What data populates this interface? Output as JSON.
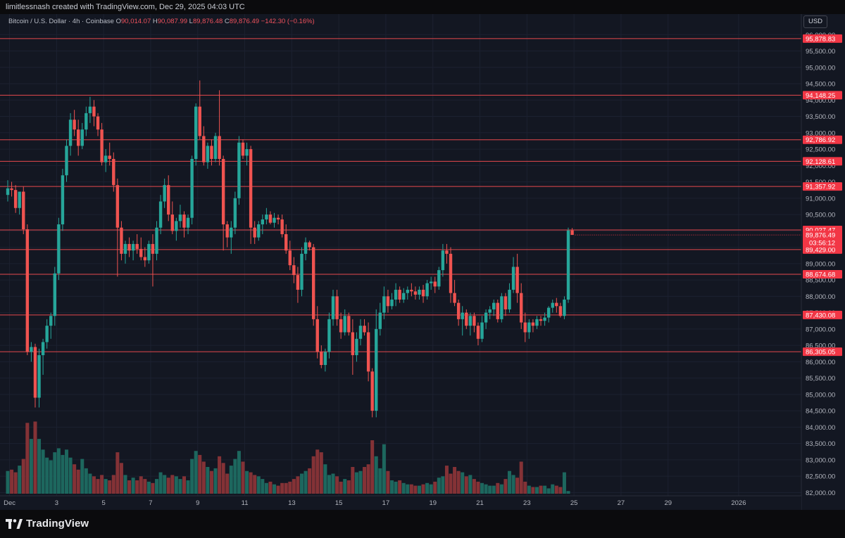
{
  "header": {
    "author": "limitlessnash created with TradingView.com, Dec 29, 2025 04:03 UTC"
  },
  "legend": {
    "symbol": "Bitcoin / U.S. Dollar · 4h · Coinbase",
    "open_label": "O",
    "open": "90,014.07",
    "high_label": "H",
    "high": "90,087.99",
    "low_label": "L",
    "low": "89,876.48",
    "close_label": "C",
    "close": "89,876.49",
    "change": "−142.30 (−0.16%)"
  },
  "currency_button": "USD",
  "brand": {
    "name": "TradingView",
    "logo_icon": "tradingview-logo-icon"
  },
  "colors": {
    "background": "#131722",
    "up": "#26a69a",
    "down": "#ef5350",
    "level_line": "#e5484d",
    "level_label_bg": "#f23645",
    "grid": "#1c2130",
    "axis_text": "#b2b5be"
  },
  "chart_data": {
    "type": "candlestick",
    "symbol": "BTC/USD",
    "exchange": "Coinbase",
    "interval": "4h",
    "grid": true,
    "ylim": [
      81900,
      96200
    ],
    "y_ticks": [
      82000,
      82500,
      83000,
      83500,
      84000,
      84500,
      85000,
      85500,
      86000,
      86500,
      87000,
      87500,
      88000,
      88500,
      89000,
      89500,
      90000,
      90500,
      91000,
      91500,
      92000,
      92500,
      93000,
      93500,
      94000,
      94500,
      95000,
      95500,
      96000
    ],
    "y_tick_labels": [
      "82,000.00",
      "82,500.00",
      "83,000.00",
      "83,500.00",
      "84,000.00",
      "84,500.00",
      "85,000.00",
      "85,500.00",
      "86,000.00",
      "86,500.00",
      "87,000.00",
      "87,500.00",
      "88,000.00",
      "88,500.00",
      "89,000.00",
      "89,500.00",
      "90,000.00",
      "90,500.00",
      "91,000.00",
      "91,500.00",
      "92,000.00",
      "92,500.00",
      "93,000.00",
      "93,500.00",
      "94,000.00",
      "94,500.00",
      "95,000.00",
      "95,500.00",
      "96,000.00"
    ],
    "x_range": [
      "2025-11-30 20:00",
      "2026-01-03 16:00"
    ],
    "x_ticks": [
      {
        "label": "Dec",
        "t": "2025-12-01 00:00"
      },
      {
        "label": "3",
        "t": "2025-12-03 00:00"
      },
      {
        "label": "5",
        "t": "2025-12-05 00:00"
      },
      {
        "label": "7",
        "t": "2025-12-07 00:00"
      },
      {
        "label": "9",
        "t": "2025-12-09 00:00"
      },
      {
        "label": "11",
        "t": "2025-12-11 00:00"
      },
      {
        "label": "13",
        "t": "2025-12-13 00:00"
      },
      {
        "label": "15",
        "t": "2025-12-15 00:00"
      },
      {
        "label": "17",
        "t": "2025-12-17 00:00"
      },
      {
        "label": "19",
        "t": "2025-12-19 00:00"
      },
      {
        "label": "21",
        "t": "2025-12-21 00:00"
      },
      {
        "label": "23",
        "t": "2025-12-23 00:00"
      },
      {
        "label": "25",
        "t": "2025-12-25 00:00"
      },
      {
        "label": "27",
        "t": "2025-12-27 00:00"
      },
      {
        "label": "29",
        "t": "2025-12-29 00:00"
      },
      {
        "label": "2026",
        "t": "2026-01-01 00:00"
      }
    ],
    "levels": [
      {
        "value": 95878.83,
        "label": "95,878.83"
      },
      {
        "value": 94148.25,
        "label": "94,148.25"
      },
      {
        "value": 92786.92,
        "label": "92,786.92"
      },
      {
        "value": 92128.61,
        "label": "92,128.61"
      },
      {
        "value": 91357.92,
        "label": "91,357.92"
      },
      {
        "value": 90027.47,
        "label": "90,027.47"
      },
      {
        "value": 89429.0,
        "label": "89,429.00"
      },
      {
        "value": 88674.68,
        "label": "88,674.68"
      },
      {
        "value": 87430.08,
        "label": "87,430.08"
      },
      {
        "value": 86305.05,
        "label": "86,305.05"
      }
    ],
    "last_price": {
      "value": 89876.49,
      "label": "89,876.49",
      "countdown": "03:56:12"
    },
    "candles": [
      [
        91100,
        91550,
        90900,
        91300
      ],
      [
        91300,
        91500,
        91050,
        91250
      ],
      [
        91250,
        91400,
        90550,
        90700
      ],
      [
        90700,
        91200,
        90500,
        91200
      ],
      [
        91200,
        91350,
        89900,
        90050
      ],
      [
        90050,
        90200,
        86200,
        86300
      ],
      [
        86300,
        86600,
        86000,
        86450
      ],
      [
        86450,
        86550,
        84600,
        84900
      ],
      [
        84900,
        86400,
        84600,
        86200
      ],
      [
        86200,
        86700,
        85600,
        86600
      ],
      [
        86600,
        87300,
        86400,
        87100
      ],
      [
        87100,
        87500,
        86700,
        87400
      ],
      [
        87400,
        88900,
        87100,
        88700
      ],
      [
        88700,
        90400,
        88500,
        90200
      ],
      [
        90200,
        91900,
        90000,
        91700
      ],
      [
        91700,
        92800,
        91500,
        92600
      ],
      [
        92600,
        93600,
        92300,
        93400
      ],
      [
        93400,
        93700,
        92900,
        93100
      ],
      [
        93100,
        93400,
        92300,
        92600
      ],
      [
        92600,
        93300,
        92500,
        93100
      ],
      [
        93100,
        93800,
        92900,
        93600
      ],
      [
        93600,
        94100,
        93300,
        93800
      ],
      [
        93800,
        94000,
        93200,
        93500
      ],
      [
        93500,
        93600,
        92900,
        93100
      ],
      [
        93100,
        93300,
        92000,
        92100
      ],
      [
        92100,
        92500,
        91800,
        92300
      ],
      [
        92300,
        92700,
        92000,
        92200
      ],
      [
        92200,
        92400,
        91200,
        91400
      ],
      [
        91400,
        91600,
        88600,
        90100
      ],
      [
        90100,
        90300,
        89100,
        89300
      ],
      [
        89300,
        89700,
        89000,
        89600
      ],
      [
        89600,
        89800,
        89200,
        89400
      ],
      [
        89400,
        89700,
        89100,
        89600
      ],
      [
        89600,
        89900,
        89300,
        89450
      ],
      [
        89450,
        89800,
        89100,
        89200
      ],
      [
        89200,
        89500,
        88900,
        89100
      ],
      [
        89100,
        89700,
        89000,
        89600
      ],
      [
        89600,
        89900,
        88300,
        89300
      ],
      [
        89300,
        90300,
        89100,
        90100
      ],
      [
        90100,
        91100,
        89900,
        90900
      ],
      [
        90900,
        91600,
        90700,
        91400
      ],
      [
        91400,
        91700,
        90300,
        90500
      ],
      [
        90500,
        90900,
        89900,
        90000
      ],
      [
        90000,
        90400,
        89700,
        90300
      ],
      [
        90300,
        90800,
        90100,
        90500
      ],
      [
        90500,
        90600,
        89800,
        90100
      ],
      [
        90100,
        90500,
        89900,
        90400
      ],
      [
        90400,
        92300,
        90200,
        92200
      ],
      [
        92200,
        93900,
        92000,
        93800
      ],
      [
        93800,
        94600,
        92800,
        92900
      ],
      [
        92900,
        93200,
        92000,
        92100
      ],
      [
        92100,
        92700,
        91900,
        92600
      ],
      [
        92600,
        92800,
        92000,
        92200
      ],
      [
        92200,
        93000,
        92100,
        92900
      ],
      [
        92900,
        94300,
        92000,
        92200
      ],
      [
        92200,
        92300,
        89400,
        90200
      ],
      [
        90200,
        90300,
        89500,
        89800
      ],
      [
        89800,
        90300,
        89300,
        90100
      ],
      [
        90100,
        91200,
        89900,
        91000
      ],
      [
        91000,
        92900,
        90800,
        92700
      ],
      [
        92700,
        92800,
        92200,
        92300
      ],
      [
        92300,
        92700,
        92000,
        92500
      ],
      [
        92500,
        92600,
        89600,
        90100
      ],
      [
        90100,
        90300,
        89600,
        89800
      ],
      [
        89800,
        90300,
        89700,
        90200
      ],
      [
        90200,
        90500,
        89900,
        90350
      ],
      [
        90350,
        90700,
        90200,
        90500
      ],
      [
        90500,
        90600,
        90200,
        90250
      ],
      [
        90250,
        90550,
        90100,
        90400
      ],
      [
        90400,
        90500,
        90200,
        90350
      ],
      [
        90350,
        90500,
        89800,
        89900
      ],
      [
        89900,
        90200,
        89300,
        89400
      ],
      [
        89400,
        89700,
        88800,
        88950
      ],
      [
        88950,
        89200,
        88400,
        88650
      ],
      [
        88650,
        88900,
        87800,
        88200
      ],
      [
        88200,
        89500,
        88000,
        89300
      ],
      [
        89300,
        89800,
        89100,
        89650
      ],
      [
        89650,
        89700,
        89400,
        89500
      ],
      [
        89500,
        89600,
        87100,
        87300
      ],
      [
        87300,
        87700,
        86100,
        86300
      ],
      [
        86300,
        86500,
        85800,
        85900
      ],
      [
        85900,
        86400,
        85700,
        86300
      ],
      [
        86300,
        87500,
        86100,
        87300
      ],
      [
        87300,
        88200,
        87100,
        88000
      ],
      [
        88000,
        88200,
        87100,
        87300
      ],
      [
        87300,
        87500,
        86700,
        86900
      ],
      [
        86900,
        87600,
        86800,
        87400
      ],
      [
        87400,
        87500,
        86800,
        86900
      ],
      [
        86900,
        87300,
        85600,
        86200
      ],
      [
        86200,
        86900,
        86000,
        86700
      ],
      [
        86700,
        87300,
        86500,
        87100
      ],
      [
        87100,
        87300,
        86800,
        86900
      ],
      [
        86900,
        87200,
        85400,
        85700
      ],
      [
        85700,
        85800,
        84300,
        84500
      ],
      [
        84500,
        87600,
        84300,
        87000
      ],
      [
        87000,
        87800,
        86800,
        87500
      ],
      [
        87500,
        88300,
        87300,
        88000
      ],
      [
        88000,
        88200,
        87500,
        87700
      ],
      [
        87700,
        88100,
        87600,
        87900
      ],
      [
        87900,
        88400,
        87700,
        88200
      ],
      [
        88200,
        88300,
        87800,
        87900
      ],
      [
        87900,
        88250,
        87800,
        88100
      ],
      [
        88100,
        88300,
        87900,
        88200
      ],
      [
        88200,
        88400,
        88000,
        88150
      ],
      [
        88150,
        88300,
        87900,
        88050
      ],
      [
        88050,
        88300,
        87900,
        88200
      ],
      [
        88200,
        88350,
        87800,
        88000
      ],
      [
        88000,
        88500,
        87900,
        88400
      ],
      [
        88400,
        88600,
        88200,
        88450
      ],
      [
        88450,
        88600,
        88100,
        88300
      ],
      [
        88300,
        88900,
        88200,
        88800
      ],
      [
        88800,
        89600,
        88600,
        89400
      ],
      [
        89400,
        89600,
        89000,
        89300
      ],
      [
        89300,
        89500,
        87800,
        88100
      ],
      [
        88100,
        88500,
        87700,
        87800
      ],
      [
        87800,
        87900,
        87100,
        87300
      ],
      [
        87300,
        87700,
        86800,
        87500
      ],
      [
        87500,
        87600,
        87000,
        87100
      ],
      [
        87100,
        87500,
        86800,
        87400
      ],
      [
        87400,
        87500,
        86900,
        87100
      ],
      [
        87100,
        87200,
        86500,
        86700
      ],
      [
        86700,
        87400,
        86600,
        87200
      ],
      [
        87200,
        87600,
        87000,
        87500
      ],
      [
        87500,
        87700,
        87300,
        87600
      ],
      [
        87600,
        87900,
        87400,
        87800
      ],
      [
        87800,
        87900,
        87200,
        87300
      ],
      [
        87300,
        88100,
        87200,
        88000
      ],
      [
        88000,
        88100,
        87400,
        87600
      ],
      [
        87600,
        88400,
        87500,
        88200
      ],
      [
        88200,
        89200,
        88100,
        88900
      ],
      [
        88900,
        89300,
        87800,
        88100
      ],
      [
        88100,
        88400,
        87000,
        87200
      ],
      [
        87200,
        87500,
        86600,
        86900
      ],
      [
        86900,
        87300,
        86700,
        87200
      ],
      [
        87200,
        87300,
        86900,
        87100
      ],
      [
        87100,
        87400,
        87000,
        87300
      ],
      [
        87300,
        87400,
        87100,
        87250
      ],
      [
        87250,
        87500,
        87100,
        87350
      ],
      [
        87350,
        87700,
        87200,
        87650
      ],
      [
        87650,
        87900,
        87500,
        87800
      ],
      [
        87800,
        87950,
        87500,
        87700
      ],
      [
        87700,
        87800,
        87350,
        87400
      ],
      [
        87400,
        88000,
        87300,
        87900
      ],
      [
        87900,
        90100,
        87800,
        90014.07
      ],
      [
        90014.07,
        90087.99,
        89876.48,
        89876.49
      ]
    ],
    "volume_scale_note": "relative bar heights, arbitrary units (no volume axis printed)",
    "volumes": [
      0.17,
      0.18,
      0.16,
      0.21,
      0.26,
      0.53,
      0.41,
      0.54,
      0.41,
      0.33,
      0.27,
      0.25,
      0.31,
      0.34,
      0.29,
      0.33,
      0.27,
      0.22,
      0.18,
      0.26,
      0.19,
      0.15,
      0.13,
      0.11,
      0.14,
      0.11,
      0.1,
      0.14,
      0.31,
      0.23,
      0.14,
      0.1,
      0.12,
      0.1,
      0.13,
      0.11,
      0.09,
      0.08,
      0.11,
      0.16,
      0.14,
      0.12,
      0.14,
      0.13,
      0.11,
      0.13,
      0.1,
      0.26,
      0.32,
      0.29,
      0.24,
      0.2,
      0.17,
      0.19,
      0.28,
      0.23,
      0.15,
      0.21,
      0.26,
      0.32,
      0.24,
      0.17,
      0.16,
      0.14,
      0.13,
      0.11,
      0.08,
      0.09,
      0.07,
      0.06,
      0.08,
      0.08,
      0.09,
      0.11,
      0.13,
      0.15,
      0.17,
      0.19,
      0.28,
      0.33,
      0.31,
      0.22,
      0.14,
      0.15,
      0.13,
      0.09,
      0.11,
      0.1,
      0.2,
      0.16,
      0.17,
      0.2,
      0.22,
      0.4,
      0.28,
      0.19,
      0.37,
      0.17,
      0.1,
      0.09,
      0.1,
      0.08,
      0.07,
      0.07,
      0.06,
      0.06,
      0.07,
      0.08,
      0.07,
      0.09,
      0.12,
      0.13,
      0.21,
      0.15,
      0.2,
      0.17,
      0.16,
      0.13,
      0.14,
      0.11,
      0.09,
      0.08,
      0.07,
      0.06,
      0.06,
      0.08,
      0.07,
      0.11,
      0.17,
      0.14,
      0.12,
      0.24,
      0.09,
      0.06,
      0.05,
      0.05,
      0.06,
      0.06,
      0.04,
      0.07,
      0.06,
      0.05,
      0.16,
      0.02
    ]
  }
}
